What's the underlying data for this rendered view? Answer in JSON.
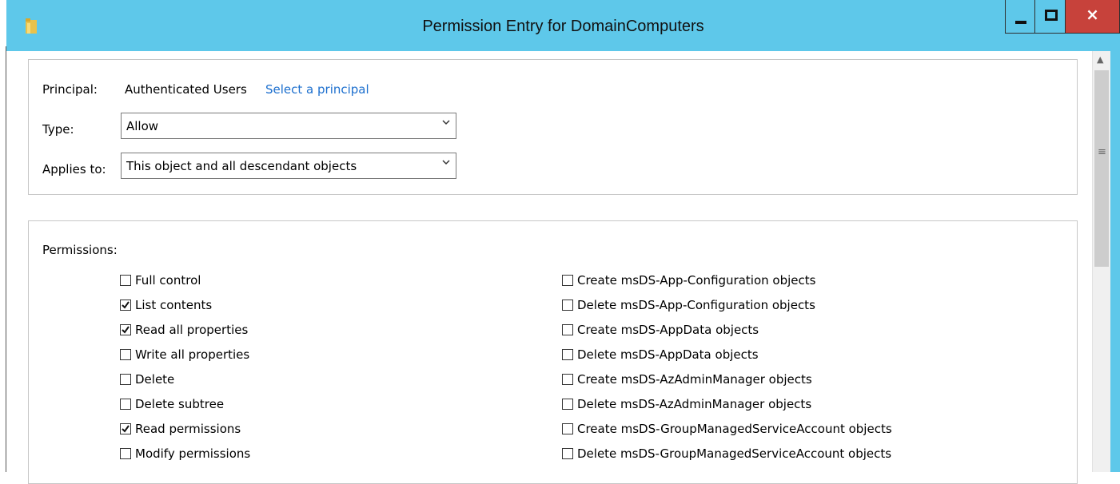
{
  "window": {
    "title": "Permission Entry for DomainComputers",
    "icon": "folder-icon",
    "controls": {
      "minimize": "minimize-icon",
      "maximize": "maximize-icon",
      "close": "×"
    }
  },
  "principal": {
    "label": "Principal:",
    "value": "Authenticated Users",
    "link": "Select a principal"
  },
  "type": {
    "label": "Type:",
    "value": "Allow"
  },
  "applies_to": {
    "label": "Applies to:",
    "value": "This object and all descendant objects"
  },
  "permissions": {
    "label": "Permissions:",
    "left": [
      {
        "label": "Full control",
        "checked": false
      },
      {
        "label": "List contents",
        "checked": true
      },
      {
        "label": "Read all properties",
        "checked": true
      },
      {
        "label": "Write all properties",
        "checked": false
      },
      {
        "label": "Delete",
        "checked": false
      },
      {
        "label": "Delete subtree",
        "checked": false
      },
      {
        "label": "Read permissions",
        "checked": true
      },
      {
        "label": "Modify permissions",
        "checked": false
      }
    ],
    "right": [
      {
        "label": "Create msDS-App-Configuration objects",
        "checked": false
      },
      {
        "label": "Delete msDS-App-Configuration objects",
        "checked": false
      },
      {
        "label": "Create msDS-AppData objects",
        "checked": false
      },
      {
        "label": "Delete msDS-AppData objects",
        "checked": false
      },
      {
        "label": "Create msDS-AzAdminManager objects",
        "checked": false
      },
      {
        "label": "Delete msDS-AzAdminManager objects",
        "checked": false
      },
      {
        "label": "Create msDS-GroupManagedServiceAccount objects",
        "checked": false
      },
      {
        "label": "Delete msDS-GroupManagedServiceAccount objects",
        "checked": false
      }
    ]
  },
  "colors": {
    "titlebar": "#5ec8ea",
    "close": "#c7423b",
    "link": "#1c6fce"
  }
}
